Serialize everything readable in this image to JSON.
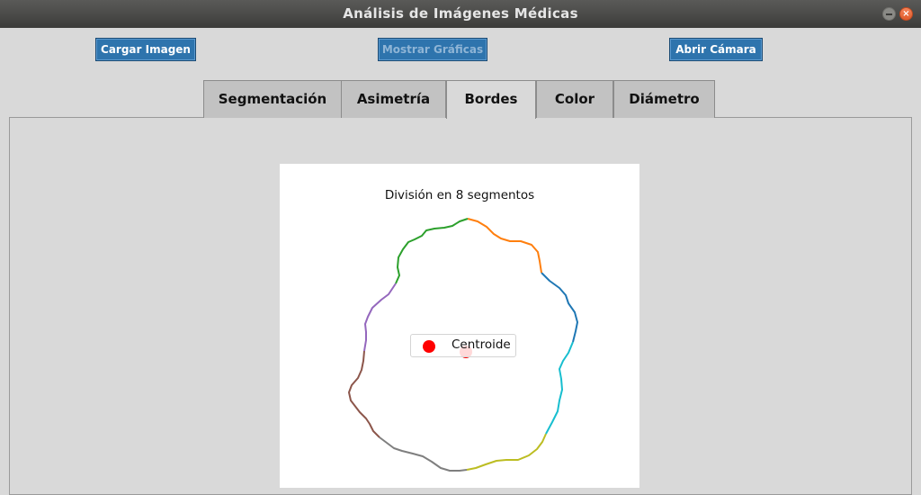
{
  "window": {
    "title": "Análisis de Imágenes Médicas"
  },
  "toolbar": {
    "load_label": "Cargar Imagen",
    "charts_label": "Mostrar Gráficas",
    "camera_label": "Abrir Cámara"
  },
  "tabs": [
    {
      "label": "Segmentación"
    },
    {
      "label": "Asimetría"
    },
    {
      "label": "Bordes",
      "active": true
    },
    {
      "label": "Color"
    },
    {
      "label": "Diámetro"
    }
  ],
  "figure": {
    "title": "División en 8 segmentos",
    "legend_label": "Centroide",
    "centroid_color": "#ff0000",
    "segment_colors": [
      "#1f77b4",
      "#ff7f0e",
      "#2ca02c",
      "#9467bd",
      "#8c564b",
      "#7f7f7f",
      "#bcbd22",
      "#17becf"
    ]
  }
}
